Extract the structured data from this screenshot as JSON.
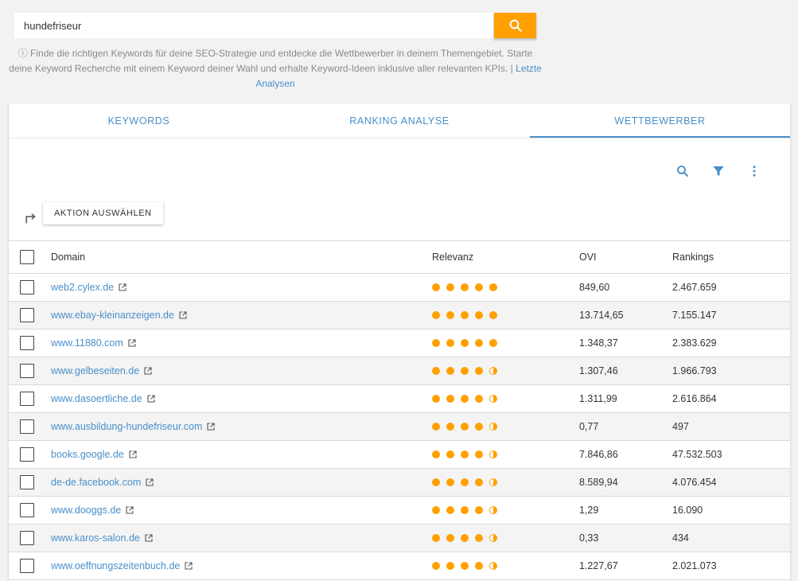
{
  "search": {
    "value": "hundefriseur",
    "button_icon": "search-icon"
  },
  "info": {
    "icon": "info-icon",
    "text": "Finde die richtigen Keywords für deine SEO-Strategie und entdecke die Wettbewerber in deinem Themengebiet. Starte deine Keyword Recherche mit einem Keyword deiner Wahl und erhalte Keyword-Ideen inklusive aller relevanten KPIs. |",
    "link": "Letzte Analysen"
  },
  "tabs": [
    {
      "label": "KEYWORDS"
    },
    {
      "label": "RANKING ANALYSE"
    },
    {
      "label": "WETTBEWERBER"
    }
  ],
  "toolbar": {
    "action_label": "AKTION AUSWÄHLEN"
  },
  "colors": {
    "accent": "#ffa000",
    "link": "#4a8fc9"
  },
  "table": {
    "headers": {
      "domain": "Domain",
      "relevance": "Relevanz",
      "ovi": "OVI",
      "rankings": "Rankings"
    },
    "rows": [
      {
        "domain": "web2.cylex.de",
        "relevance": 5,
        "ovi": "849,60",
        "rankings": "2.467.659"
      },
      {
        "domain": "www.ebay-kleinanzeigen.de",
        "relevance": 5,
        "ovi": "13.714,65",
        "rankings": "7.155.147"
      },
      {
        "domain": "www.11880.com",
        "relevance": 5,
        "ovi": "1.348,37",
        "rankings": "2.383.629"
      },
      {
        "domain": "www.gelbeseiten.de",
        "relevance": 4.5,
        "ovi": "1.307,46",
        "rankings": "1.966.793"
      },
      {
        "domain": "www.dasoertliche.de",
        "relevance": 4.5,
        "ovi": "1.311,99",
        "rankings": "2.616.864"
      },
      {
        "domain": "www.ausbildung-hundefriseur.com",
        "relevance": 4.5,
        "ovi": "0,77",
        "rankings": "497"
      },
      {
        "domain": "books.google.de",
        "relevance": 4.5,
        "ovi": "7.846,86",
        "rankings": "47.532.503"
      },
      {
        "domain": "de-de.facebook.com",
        "relevance": 4.5,
        "ovi": "8.589,94",
        "rankings": "4.076.454"
      },
      {
        "domain": "www.dooggs.de",
        "relevance": 4.5,
        "ovi": "1,29",
        "rankings": "16.090"
      },
      {
        "domain": "www.karos-salon.de",
        "relevance": 4.5,
        "ovi": "0,33",
        "rankings": "434"
      },
      {
        "domain": "www.oeffnungszeitenbuch.de",
        "relevance": 4.5,
        "ovi": "1.227,67",
        "rankings": "2.021.073"
      }
    ]
  }
}
